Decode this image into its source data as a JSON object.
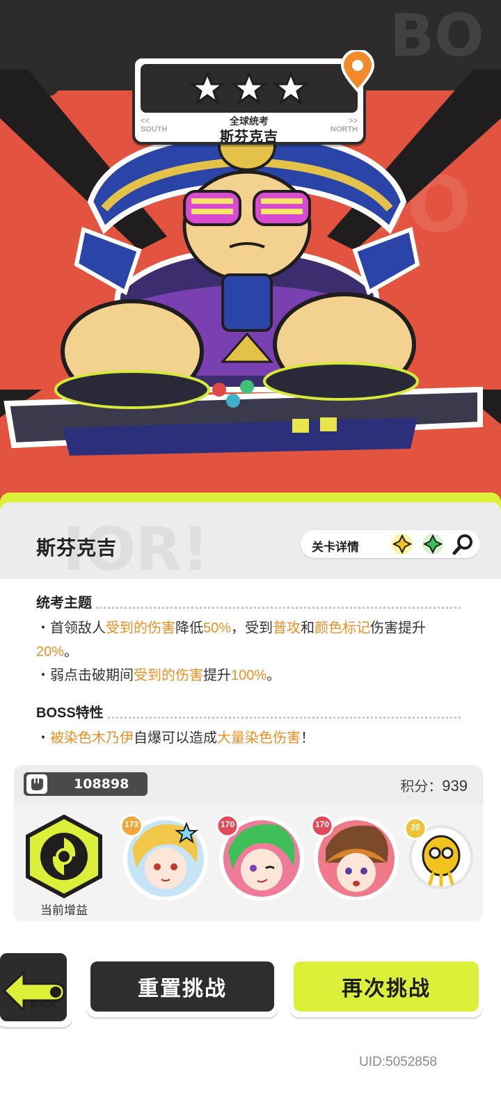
{
  "stage": {
    "stars_earned": 3,
    "stars_total": 3,
    "subtitle": "全球统考",
    "boss_name": "斯芬克吉",
    "nav_left_arrow": "<<",
    "nav_left": "SOUTH",
    "nav_right_arrow": ">>",
    "nav_right": "NORTH"
  },
  "panel": {
    "boss_name": "斯芬克吉",
    "detail_label": "关卡详情",
    "bg_word": "IOR!",
    "theme_title": "统考主题",
    "theme_lines": [
      {
        "bullet": "・首领敌人",
        "hl1": "受到的伤害",
        "t1": "降低",
        "hl2": "50%",
        "t2": "，受到",
        "hl3": "普攻",
        "t3": "和",
        "hl4": "颜色标记",
        "t4": "伤害提升",
        "hl5": "20%",
        "t5": "。"
      },
      {
        "bullet": "・弱点击破期间",
        "hl1": "受到的伤害",
        "t1": "提升",
        "hl2": "100%",
        "t2": "。"
      }
    ],
    "boss_title": "BOSS特性",
    "boss_line": {
      "bullet": "・",
      "hl1": "被染色木乃伊",
      "t1": "自爆可以造成",
      "hl2": "大量染色伤害",
      "t2": "！"
    }
  },
  "team": {
    "power_value": "108898",
    "score_label": "积分：",
    "score_value": "939",
    "buff_label": "当前增益",
    "members": [
      {
        "level": "173",
        "icon": "blonde-girl-avatar"
      },
      {
        "level": "170",
        "icon": "green-hair-avatar"
      },
      {
        "level": "170",
        "icon": "brown-hair-avatar"
      },
      {
        "level": "20",
        "icon": "yellow-creature-avatar"
      }
    ]
  },
  "buttons": {
    "back_label": "BACK",
    "reset_label": "重置挑战",
    "retry_label": "再次挑战"
  },
  "footer": {
    "uid": "UID:5052858"
  },
  "colors": {
    "hero_bg": "#e2543f",
    "dark": "#2d2b2b",
    "lime": "#dcf03a",
    "highlight": "#ee8f22"
  }
}
